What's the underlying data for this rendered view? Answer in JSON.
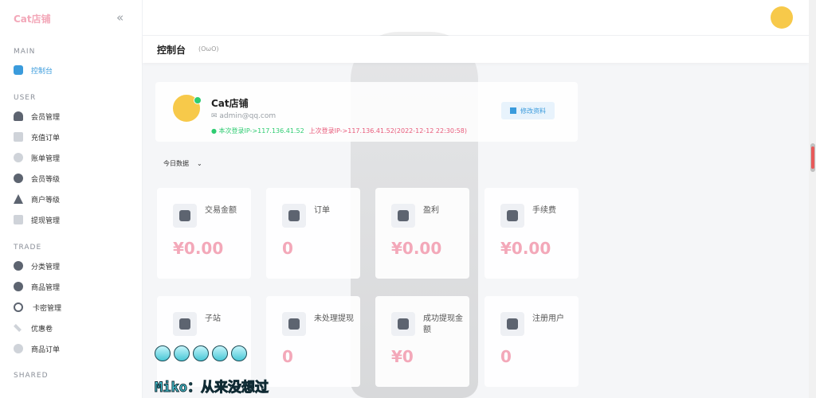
{
  "brand": "Cat店铺",
  "sidebar": {
    "sections": [
      {
        "title": "MAIN",
        "items": [
          {
            "label": "控制台"
          }
        ]
      },
      {
        "title": "USER",
        "items": [
          {
            "label": "会员管理"
          },
          {
            "label": "充值订单"
          },
          {
            "label": "账单管理"
          },
          {
            "label": "会员等级"
          },
          {
            "label": "商户等级"
          },
          {
            "label": "提现管理"
          }
        ]
      },
      {
        "title": "TRADE",
        "items": [
          {
            "label": "分类管理"
          },
          {
            "label": "商品管理"
          },
          {
            "label": "卡密管理"
          },
          {
            "label": "优惠卷"
          },
          {
            "label": "商品订单"
          }
        ]
      },
      {
        "title": "SHARED",
        "items": []
      }
    ]
  },
  "header": {
    "title": "控制台",
    "subtitle": "(OωO)"
  },
  "profile": {
    "name": "Cat店铺",
    "email": "admin@qq.com",
    "current_login": "本次登录IP->117.136.41.52",
    "last_login": "上次登录IP->117.136.41.52(2022-12-12 22:30:58)",
    "edit_label": "修改资料"
  },
  "filter": {
    "label": "今日数据"
  },
  "stats": [
    {
      "label": "交易金额",
      "value": "¥0.00",
      "icon": "bag-icon"
    },
    {
      "label": "订单",
      "value": "0",
      "icon": "pie-icon"
    },
    {
      "label": "盈利",
      "value": "¥0.00",
      "icon": "pie-icon"
    },
    {
      "label": "手续费",
      "value": "¥0.00",
      "icon": "coin-icon"
    },
    {
      "label": "子站",
      "value": "",
      "icon": "house-icon"
    },
    {
      "label": "未处理提现",
      "value": "0",
      "icon": "dollar-icon"
    },
    {
      "label": "成功提现金额",
      "value": "¥0",
      "icon": "filter-coin-icon"
    },
    {
      "label": "注册用户",
      "value": "0",
      "icon": "user-add-icon"
    }
  ],
  "overlay": {
    "caption": "Miko：从来没想过"
  },
  "colors": {
    "accent": "#3a9bdc",
    "value_pink": "#f3a8b9",
    "online_green": "#2ecc71"
  }
}
